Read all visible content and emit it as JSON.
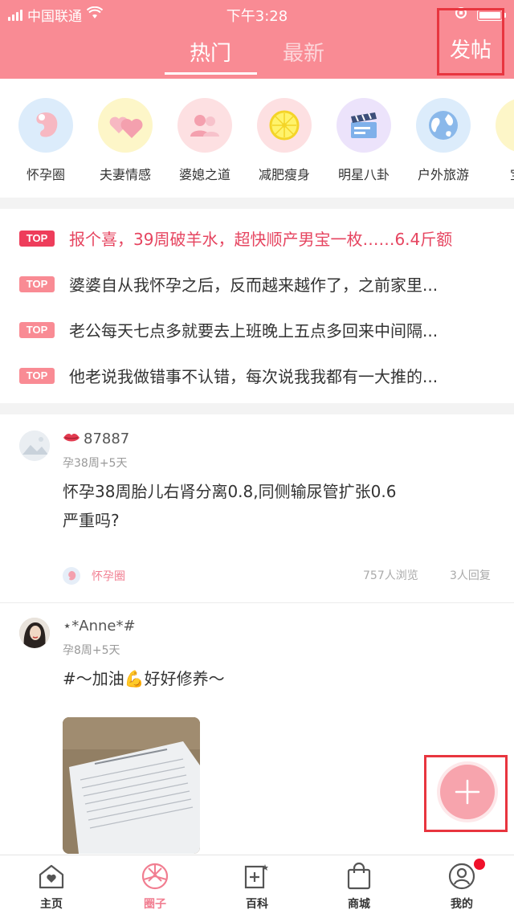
{
  "statusbar": {
    "carrier": "中国联通",
    "time": "下午3:28"
  },
  "header": {
    "tabs": [
      {
        "label": "热门",
        "active": true
      },
      {
        "label": "最新",
        "active": false
      }
    ],
    "post_label": "发帖",
    "bg_color": "#f98b94"
  },
  "categories": [
    {
      "label": "怀孕圈",
      "icon": "pregnancy-icon",
      "color": "#dcecfb"
    },
    {
      "label": "夫妻情感",
      "icon": "hearts-icon",
      "color": "#fdf6c8"
    },
    {
      "label": "婆媳之道",
      "icon": "people-icon",
      "color": "#fde0e2"
    },
    {
      "label": "减肥瘦身",
      "icon": "lemon-icon",
      "color": "#fde0e2"
    },
    {
      "label": "明星八卦",
      "icon": "clapperboard-icon",
      "color": "#ece3fb"
    },
    {
      "label": "户外旅游",
      "icon": "globe-icon",
      "color": "#dcecfb"
    },
    {
      "label": "宝宝",
      "icon": "baby-icon",
      "color": "#fdf6c8"
    }
  ],
  "top_posts": [
    {
      "badge": "TOP",
      "text": "报个喜，39周破羊水，超快顺产男宝一枚……6.4斤额",
      "highlight": true
    },
    {
      "badge": "TOP",
      "text": "婆婆自从我怀孕之后，反而越来越作了，之前家里...",
      "highlight": false
    },
    {
      "badge": "TOP",
      "text": "老公每天七点多就要去上班晚上五点多回来中间隔...",
      "highlight": false
    },
    {
      "badge": "TOP",
      "text": "他老说我做错事不认错，每次说我我都有一大推的...",
      "highlight": false
    }
  ],
  "posts": [
    {
      "username": "87887",
      "stage": "孕38周+5天",
      "content_line1": "怀孕38周胎儿右肾分离0.8,同侧输尿管扩张0.6",
      "content_line2": "严重吗?",
      "circle": "怀孕圈",
      "views": "757人浏览",
      "replies": "3人回复"
    },
    {
      "username": "⋆*Anne*#",
      "stage": "孕8周+5天",
      "content": "#～加油💪好好修养～"
    }
  ],
  "bottom_nav": [
    {
      "label": "主页",
      "icon": "home-icon",
      "active": false
    },
    {
      "label": "圈子",
      "icon": "circle-icon",
      "active": true
    },
    {
      "label": "百科",
      "icon": "encyclopedia-icon",
      "active": false
    },
    {
      "label": "商城",
      "icon": "shopping-bag-icon",
      "active": false
    },
    {
      "label": "我的",
      "icon": "profile-icon",
      "active": false
    }
  ],
  "colors": {
    "accent": "#f98b94",
    "hot_text": "#e64560",
    "notify_dot": "#f0102a"
  }
}
